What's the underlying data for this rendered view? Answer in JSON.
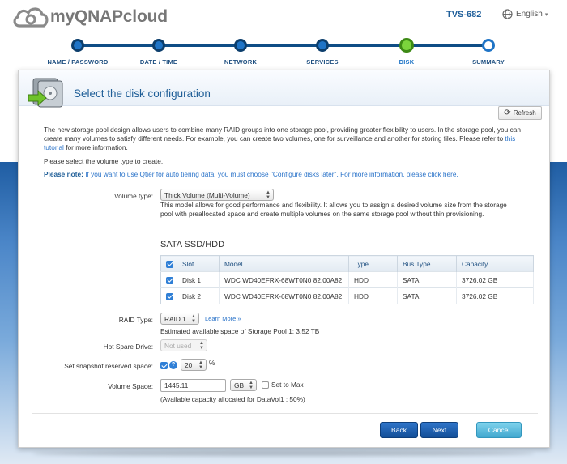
{
  "app": {
    "logo_text": "myQNAPcloud",
    "device": "TVS-682",
    "language": "English"
  },
  "steps": [
    {
      "label": "NAME / PASSWORD",
      "state": "done"
    },
    {
      "label": "DATE / TIME",
      "state": "done"
    },
    {
      "label": "NETWORK",
      "state": "done"
    },
    {
      "label": "SERVICES",
      "state": "done"
    },
    {
      "label": "DISK",
      "state": "current"
    },
    {
      "label": "SUMMARY",
      "state": "future"
    }
  ],
  "panel": {
    "title": "Select the disk configuration",
    "refresh_label": "Refresh",
    "intro_text": "The new storage pool design allows users to combine many RAID groups into one storage pool, providing greater flexibility to users. In the storage pool, you can create many volumes to satisfy different needs. For example, you can create two volumes, one for surveillance and another for storing files. Please refer to",
    "intro_link": "this tutorial",
    "intro_tail": "for more information.",
    "select_msg": "Please select the volume type to create.",
    "note_label": "Please note:",
    "note_text": "If you want to use Qtier for auto tiering data, you must choose \"Configure disks later\". For more information, please click",
    "note_link": "here",
    "note_tail": "."
  },
  "form": {
    "volume_type_label": "Volume type:",
    "volume_type_value": "Thick Volume (Multi-Volume)",
    "volume_desc": "This model allows for good performance and flexibility. It allows you to assign a desired volume size from the storage pool with preallocated space and create multiple volumes on the same storage pool without thin provisioning.",
    "sata_title": "SATA SSD/HDD",
    "raid_label": "RAID Type:",
    "raid_value": "RAID 1",
    "learn_more": "Learn More »",
    "estimate": "Estimated available space of Storage Pool 1: 3.52 TB",
    "hot_spare_label": "Hot Spare Drive:",
    "hot_spare_value": "Not used",
    "snapshot_label": "Set snapshot reserved space:",
    "snapshot_value": "20",
    "snapshot_unit": "%",
    "volume_space_label": "Volume Space:",
    "volume_space_value": "1445.11",
    "volume_space_unit": "GB",
    "set_to_max": "Set to Max",
    "available_note": "(Available capacity allocated for DataVol1 : 50%)"
  },
  "table": {
    "headers": [
      "Slot",
      "Model",
      "Type",
      "Bus Type",
      "Capacity"
    ],
    "rows": [
      {
        "slot": "Disk 1",
        "model": "WDC WD40EFRX-68WT0N0 82.00A82",
        "type": "HDD",
        "bus": "SATA",
        "capacity": "3726.02 GB"
      },
      {
        "slot": "Disk 2",
        "model": "WDC WD40EFRX-68WT0N0 82.00A82",
        "type": "HDD",
        "bus": "SATA",
        "capacity": "3726.02 GB"
      }
    ]
  },
  "buttons": {
    "back": "Back",
    "next": "Next",
    "cancel": "Cancel"
  }
}
